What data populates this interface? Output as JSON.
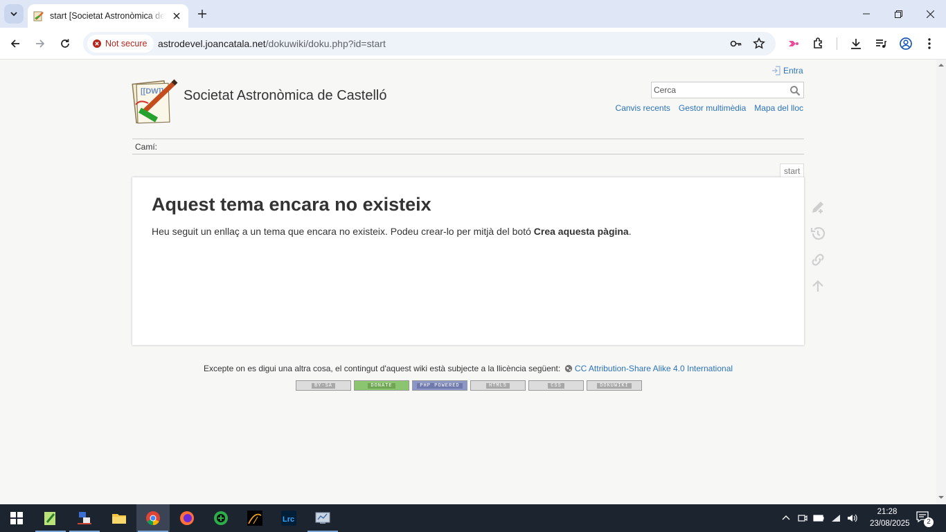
{
  "browser": {
    "tab_title": "start [Societat Astronòmica de Castelló]",
    "security_label": "Not secure",
    "url_host": "astrodevel.joancatala.net",
    "url_path": "/dokuwiki/doku.php?id=start"
  },
  "site": {
    "login_label": "Entra",
    "title": "Societat Astronòmica de Castelló",
    "search_placeholder": "Cerca",
    "tools": [
      "Canvis recents",
      "Gestor multimèdia",
      "Mapa del lloc"
    ],
    "breadcrumb_label": "Camí:",
    "page_id": "start"
  },
  "content": {
    "heading": "Aquest tema encara no existeix",
    "text_before": "Heu seguit un enllaç a un tema que encara no existeix. Podeu crear-lo per mitjà del botó ",
    "text_strong": "Crea aquesta pàgina",
    "text_after": "."
  },
  "page_tools": [
    "edit-page-icon",
    "old-revisions-icon",
    "backlinks-icon",
    "back-to-top-icon"
  ],
  "footer": {
    "license_text": "Excepte on es digui una altra cosa, el contingut d'aquest wiki està subjecte a la llicència següent:",
    "license_link": "CC Attribution-Share Alike 4.0 International",
    "badges": [
      "BY-SA",
      "DONATE",
      "PHP POWERED",
      "HTML5",
      "CSS",
      "DOKUWIKI"
    ]
  },
  "taskbar": {
    "time": "21:28",
    "date": "23/08/2025",
    "notification_count": "2"
  },
  "colors": {
    "link": "#2b73b7",
    "tabstrip": "#dfe7f7",
    "taskbar": "#1c2430",
    "not_secure": "#b3261e"
  }
}
